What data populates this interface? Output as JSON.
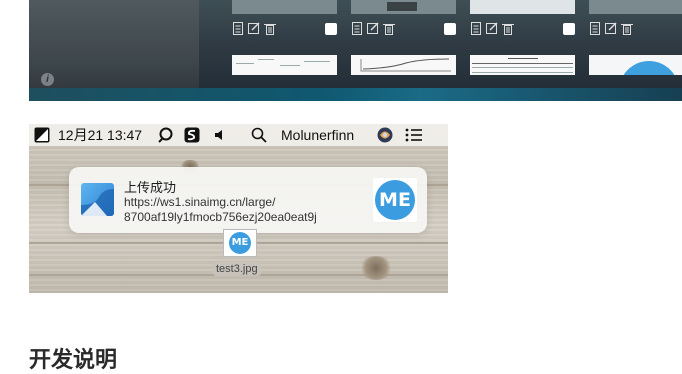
{
  "top_panel": {
    "info_icon": "info-icon",
    "thumbnail_actions": [
      "document-icon",
      "edit-icon",
      "trash-icon"
    ]
  },
  "menubar": {
    "date_time": "12月21 13:47",
    "user_name": "Molunerfinn",
    "icons": [
      "picgo-icon",
      "date-time",
      "search-app-icon",
      "s-app-icon",
      "volume-icon",
      "spotlight-icon",
      "user-name",
      "avatar-icon",
      "list-icon"
    ]
  },
  "notification": {
    "title": "上传成功",
    "body_line1": "https://ws1.sinaimg.cn/large/",
    "body_line2": "8700af19ly1fmocb756ezj20ea0eat9j",
    "image_text": "ME"
  },
  "desktop": {
    "file_name": "test3.jpg",
    "file_icon_text": "ME"
  },
  "heading": {
    "text": "开发说明"
  }
}
